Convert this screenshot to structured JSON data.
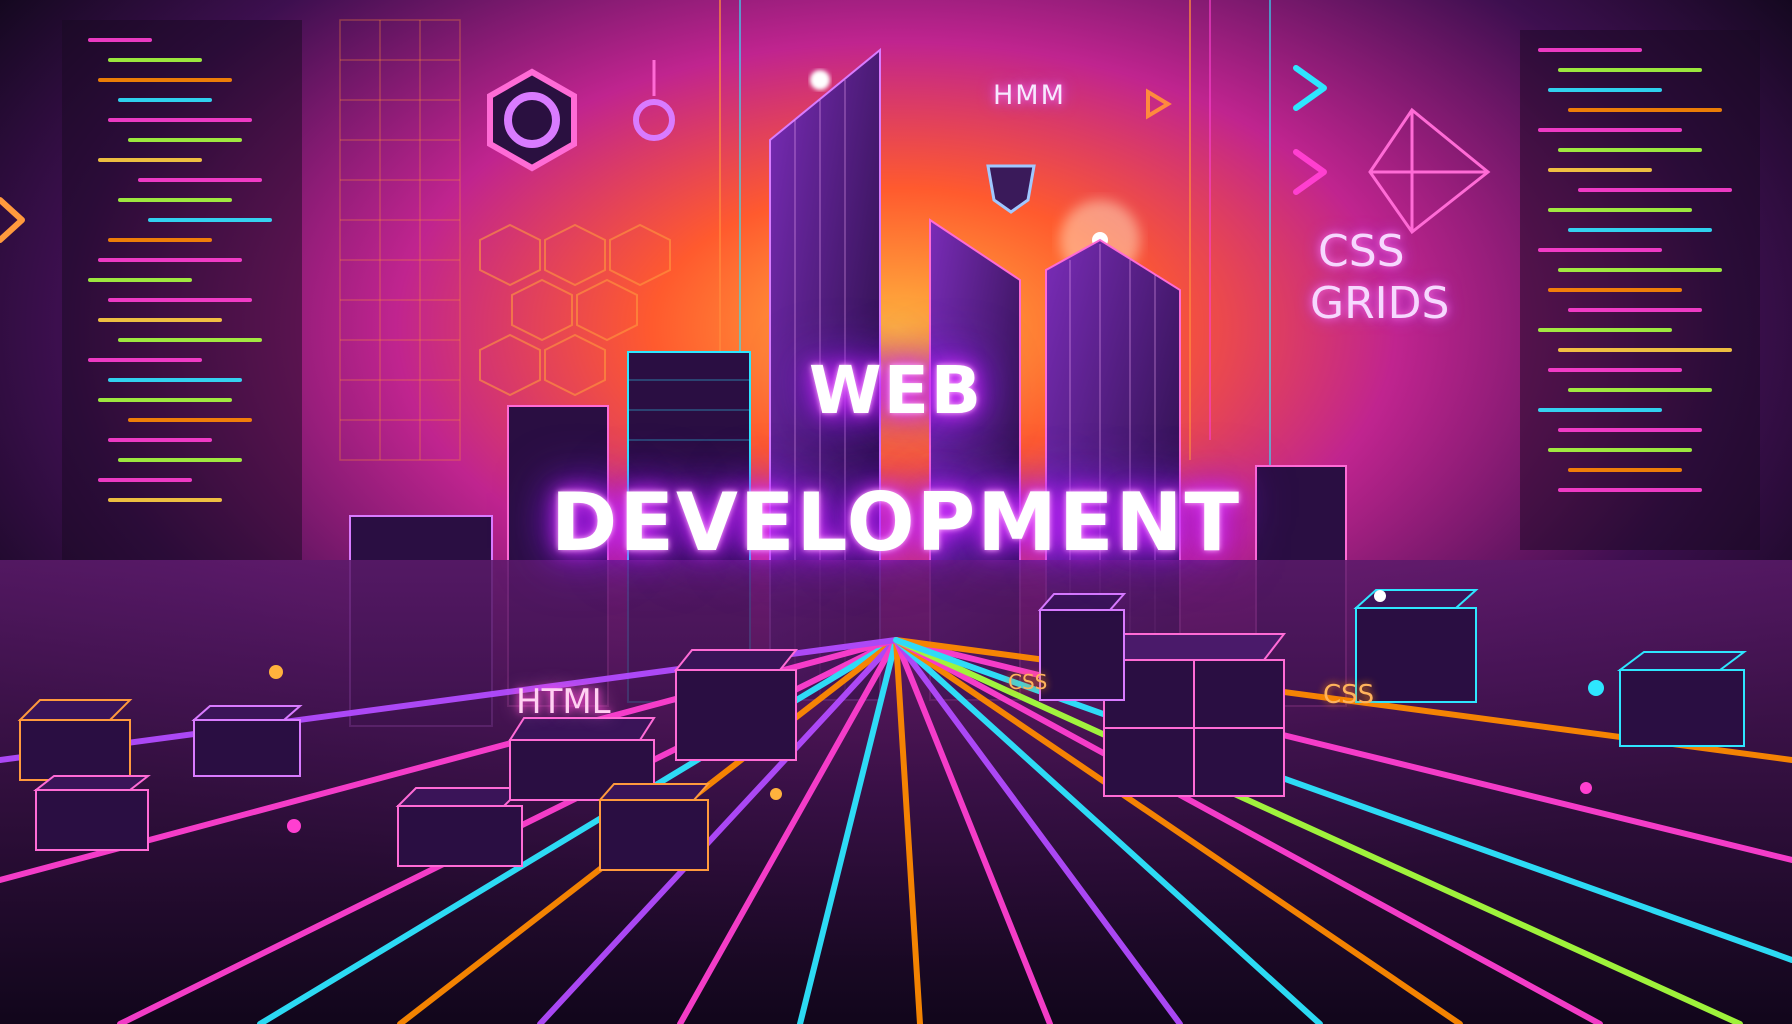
{
  "hero": {
    "line1": "WEB",
    "line2": "DEVELOPMENT"
  },
  "labels": {
    "hmm": "HMM",
    "css_grids_line1": "CSS",
    "css_grids_line2": "GRIDS",
    "html_sign": "HTML",
    "css_small": "CSS",
    "css_sign": "CSS"
  },
  "icons": [
    "hexagon-ring-icon",
    "ring-icon",
    "chevron-right-icon",
    "play-arrow-icon",
    "shield-emblem-icon",
    "diamond-crystal-icon"
  ],
  "colors": {
    "background": "#0c0716",
    "magenta": "#ff3fd0",
    "violet": "#b24bff",
    "orange": "#ff8a00",
    "cyan": "#2ee6ff",
    "lime": "#a6ff3d"
  }
}
